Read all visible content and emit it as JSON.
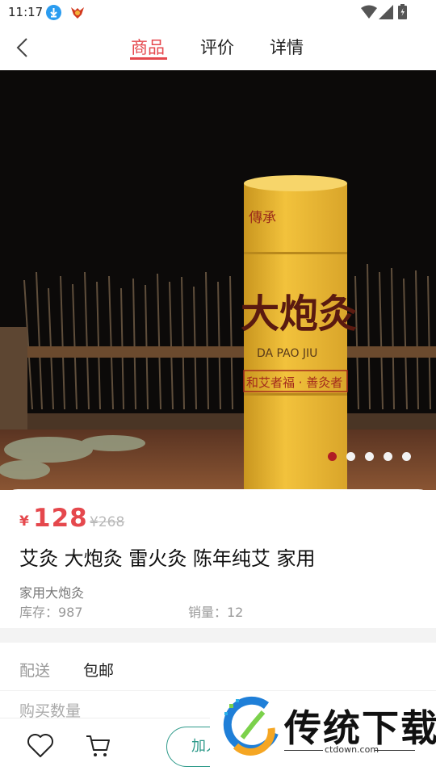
{
  "status_bar": {
    "time": "11:17",
    "icons": [
      "download-icon",
      "app-icon",
      "wifi-icon",
      "signal-icon",
      "battery-icon"
    ]
  },
  "header": {
    "tabs": [
      {
        "label": "商品",
        "active": true
      },
      {
        "label": "评价",
        "active": false
      },
      {
        "label": "详情",
        "active": false
      }
    ],
    "accent_color": "#e5484d"
  },
  "gallery": {
    "product_label_top": "傳承",
    "product_label_main": "大炮灸",
    "product_label_pinyin": "DA PAO JIU",
    "product_label_slogan": "和艾者福 · 善灸者",
    "dots_total": 5,
    "active_dot": 1
  },
  "product": {
    "currency": "¥",
    "price": "128",
    "original_price": "¥268",
    "title": "艾灸 大炮灸 雷火灸 陈年纯艾 家用",
    "subtitle": "家用大炮灸",
    "stock": "库存：987",
    "sales": "销量：12"
  },
  "shipping": {
    "label": "配送",
    "value": "包邮"
  },
  "quantity": {
    "label": "购买数量"
  },
  "bottom_bar": {
    "add_to_cart_label": "加入",
    "button_color": "#2e9a8a"
  },
  "watermark": {
    "name": "传统下载",
    "url": "ctdown.com"
  }
}
